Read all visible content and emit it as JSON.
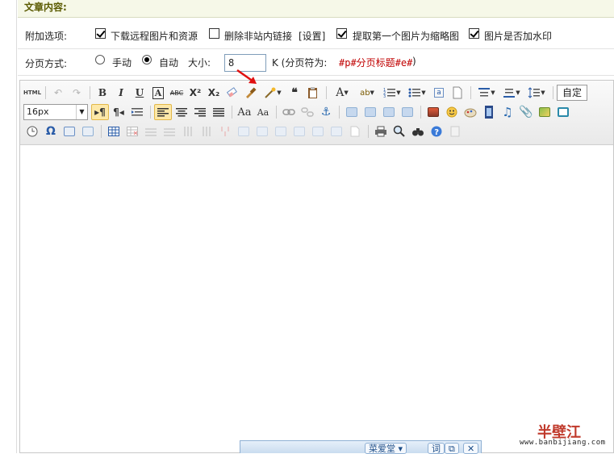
{
  "section": {
    "title": "文章内容:"
  },
  "options": {
    "label": "附加选项:",
    "items": [
      {
        "label": "下载远程图片和资源",
        "checked": true
      },
      {
        "label": "删除非站内链接",
        "checked": false
      },
      {
        "label": "[设置]",
        "checked": null
      },
      {
        "label": "提取第一个图片为缩略图",
        "checked": true
      },
      {
        "label": "图片是否加水印",
        "checked": true
      }
    ]
  },
  "paging": {
    "label": "分页方式:",
    "manual_label": "手动",
    "auto_label": "自动",
    "selected": "自动",
    "size_label": "大小:",
    "size_value": "8",
    "unit_prefix": "K (分页符为:",
    "separator_code": "#p#分页标题#e#",
    "unit_suffix": ")"
  },
  "editor": {
    "font_size": "16px",
    "custom_style": "自定",
    "toolbar_row1": [
      "HTML",
      "undo",
      "redo",
      "B",
      "I",
      "U",
      "A-box",
      "ABC",
      "X²",
      "X₂",
      "eraser",
      "brush",
      "magic-wand",
      "66",
      "paste-word",
      "A",
      "highlight",
      "ordered-list",
      "unordered-list",
      "select-all",
      "new-doc",
      "line-height",
      "indent",
      "paragraph-spacing"
    ],
    "toolbar_row2": [
      "ltr",
      "rtl",
      "block-quote",
      "align-left",
      "align-center",
      "align-right",
      "justify",
      "font-increase",
      "font-decrease",
      "link",
      "unlink",
      "anchor",
      "img-left",
      "img-inline",
      "img-right",
      "img-center",
      "image",
      "emoticon",
      "scrawl",
      "video",
      "music",
      "attachment",
      "map",
      "frame"
    ],
    "toolbar_row3": [
      "time",
      "omega",
      "insert-code",
      "insert-template",
      "table",
      "delete-table",
      "insert-row",
      "delete-row",
      "insert-col",
      "delete-col",
      "merge",
      "split-row",
      "split-col",
      "merge-cells",
      "merge-right",
      "merge-down",
      "page-break",
      "print",
      "preview",
      "search-replace",
      "help",
      "clear"
    ],
    "accent_active": "#fde8a8"
  },
  "bottom_bar": {
    "tab_label": "菜爱堂",
    "btn1": "词",
    "btn2": "⧉",
    "btn3": "✕"
  },
  "watermark": {
    "title": "半壁江",
    "url": "www.banbijiang.com"
  }
}
